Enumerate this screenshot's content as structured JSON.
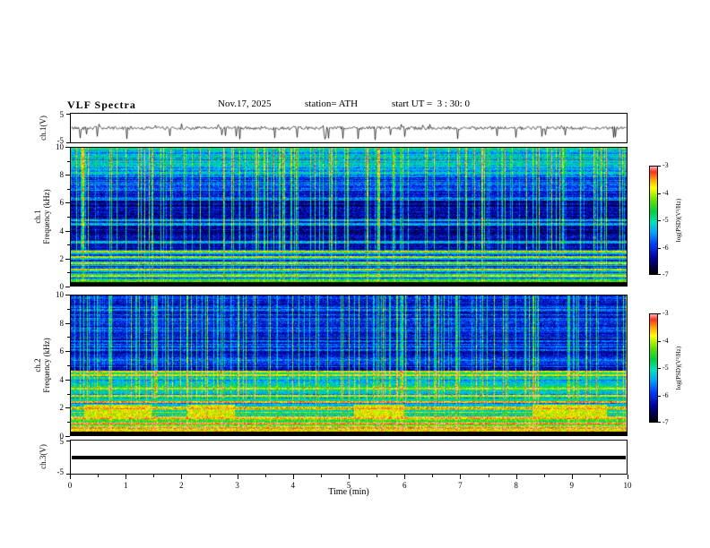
{
  "header": {
    "title": "VLF Spectra",
    "date": "Nov.17, 2025",
    "station": "station= ATH",
    "start_ut": "start UT =  3 : 30: 0"
  },
  "x_axis": {
    "label": "Time (min)",
    "range": [
      0,
      10
    ],
    "major_ticks": [
      0,
      1,
      2,
      3,
      4,
      5,
      6,
      7,
      8,
      9,
      10
    ]
  },
  "panels": {
    "ch1_wave": {
      "label": "ch.1(V)",
      "y_top": "5",
      "y_bottom": "-5"
    },
    "ch1_spec": {
      "label_line1": "ch.1",
      "label_line2": "Frequency (kHz)",
      "y_ticks": [
        0,
        2,
        4,
        6,
        8,
        10
      ]
    },
    "ch2_spec": {
      "label_line1": "ch.2",
      "label_line2": "Frequency (kHz)",
      "y_ticks": [
        0,
        2,
        4,
        6,
        8,
        10
      ]
    },
    "ch3_wave": {
      "label": "ch.3(V)",
      "y_top": "5",
      "y_bottom": "-5"
    }
  },
  "colorbar": {
    "label": "log(PSD)(V²/Hz)",
    "ticks": [
      "-3",
      "-4",
      "-5",
      "-6",
      "-7"
    ],
    "stops": [
      {
        "t": 0.0,
        "c": "#000000"
      },
      {
        "t": 0.06,
        "c": "#000040"
      },
      {
        "t": 0.15,
        "c": "#0000a0"
      },
      {
        "t": 0.28,
        "c": "#0040ff"
      },
      {
        "t": 0.38,
        "c": "#00a0ff"
      },
      {
        "t": 0.48,
        "c": "#00e0c0"
      },
      {
        "t": 0.58,
        "c": "#00d040"
      },
      {
        "t": 0.68,
        "c": "#60e000"
      },
      {
        "t": 0.8,
        "c": "#ffff00"
      },
      {
        "t": 0.88,
        "c": "#ffa000"
      },
      {
        "t": 0.95,
        "c": "#ff3020"
      },
      {
        "t": 1.0,
        "c": "#ffb0b0"
      }
    ]
  },
  "chart_data": [
    {
      "type": "line",
      "panel": "ch1_waveform",
      "x_range_min": [
        0,
        10
      ],
      "y_range_V": [
        -5,
        5
      ],
      "description": "Noisy trace around 0 V with ~±0.6 V jitter and frequent impulsive negative spikes down to about -4.5 V",
      "noise_amp_V": 0.55,
      "spike_probability": 0.06,
      "spike_range_V": [
        2.0,
        4.5
      ]
    },
    {
      "type": "heatmap",
      "panel": "ch1_spectrogram",
      "x_range_min": [
        0,
        10
      ],
      "y_range_kHz": [
        0,
        10
      ],
      "z_label": "log(PSD)(V²/Hz)",
      "z_range": [
        -7,
        -3
      ],
      "description": "Dark-blue background 2.6-6 kHz with dense bright vertical sferic streaks; green/yellow horizontal striations below 2.6 kHz; green speckle above 8 kHz; black band near 0 kHz",
      "bands": [
        {
          "f": [
            0,
            0.28
          ],
          "level": -7.0,
          "spread": 0.05
        },
        {
          "f": [
            0.28,
            2.6
          ],
          "level": -5.4,
          "spread": 1.1
        },
        {
          "f": [
            2.6,
            6.2
          ],
          "level": -6.45,
          "spread": 0.3
        },
        {
          "f": [
            6.2,
            8.0
          ],
          "level": -5.9,
          "spread": 0.45
        },
        {
          "f": [
            8.0,
            10.01
          ],
          "level": -5.25,
          "spread": 0.55
        }
      ],
      "horizontal_lines_kHz": [
        0.7,
        1.15,
        1.6,
        2.1,
        2.45,
        3.15,
        4.45,
        4.75
      ],
      "vertical_streaks": {
        "probability": 0.3,
        "max_boost": 2.7
      }
    },
    {
      "type": "heatmap",
      "panel": "ch2_spectrogram",
      "x_range_min": [
        0,
        10
      ],
      "y_range_kHz": [
        0,
        10
      ],
      "z_label": "log(PSD)(V²/Hz)",
      "z_range": [
        -7,
        -3
      ],
      "description": "Strong yellow/green banded emission below 2.6 kHz with red/orange patches near 1.4-2.1 kHz; green 2.6-4.6 kHz; blue with vertical streaks above 4.6 kHz; black band near 0 kHz",
      "bands": [
        {
          "f": [
            0,
            0.28
          ],
          "level": -7.0,
          "spread": 0.05
        },
        {
          "f": [
            0.28,
            1.0
          ],
          "level": -4.6,
          "spread": 0.9
        },
        {
          "f": [
            1.0,
            2.6
          ],
          "level": -4.9,
          "spread": 0.9
        },
        {
          "f": [
            2.6,
            4.6
          ],
          "level": -5.15,
          "spread": 0.55
        },
        {
          "f": [
            4.6,
            10.01
          ],
          "level": -6.05,
          "spread": 0.45
        }
      ],
      "horizontal_lines_kHz": [
        0.5,
        0.85,
        1.25,
        1.9,
        2.35,
        2.8,
        3.35,
        4.3,
        4.55
      ],
      "vertical_streaks": {
        "probability": 0.24,
        "max_boost": 2.4
      },
      "blobs": [
        {
          "f": [
            1.35,
            2.15
          ],
          "level": -3.45,
          "t": [
            [
              0.25,
              1.45
            ],
            [
              2.1,
              2.95
            ],
            [
              5.1,
              6.0
            ],
            [
              8.3,
              9.65
            ]
          ]
        }
      ]
    },
    {
      "type": "line",
      "panel": "ch3_waveform",
      "x_range_min": [
        0,
        10
      ],
      "y_range_V": [
        -5,
        5
      ],
      "value_V": 0,
      "description": "Flat saturated black bar at 0 V (constant signal, no variation)"
    }
  ]
}
